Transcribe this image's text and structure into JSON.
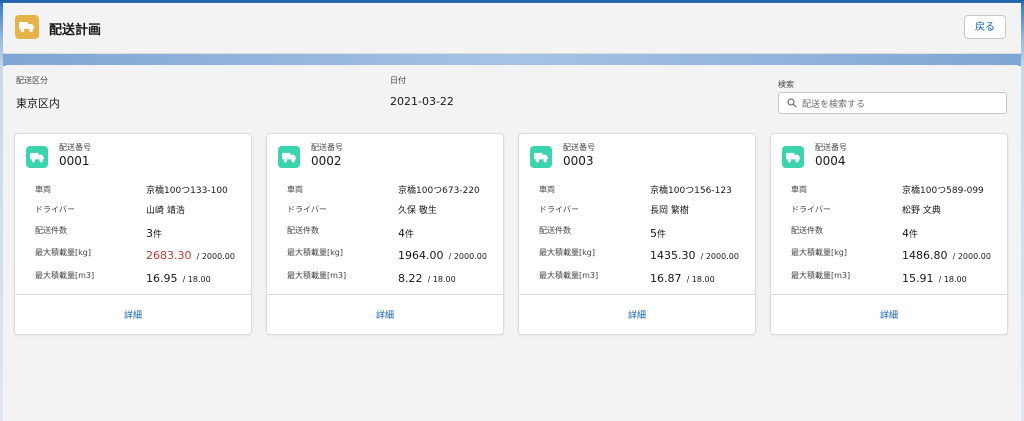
{
  "header": {
    "title": "配送計画",
    "back_label": "戻る"
  },
  "filters": {
    "area_label": "配送区分",
    "area_value": "東京区内",
    "date_label": "日付",
    "date_value": "2021-03-22",
    "search_label": "検索",
    "search_placeholder": "配送を検索する"
  },
  "card_labels": {
    "number": "配送番号",
    "vehicle": "車両",
    "driver": "ドライバー",
    "count": "配送件数",
    "max_weight": "最大積載量[kg]",
    "max_volume": "最大積載量[m3]",
    "detail": "詳細"
  },
  "colors": {
    "accent": "#0b5cab",
    "over_capacity": "#c23934",
    "truck_icon_bg": "#3bd4ae",
    "header_icon_bg": "#e4b448"
  },
  "cards": [
    {
      "number": "0001",
      "vehicle": "京橋100つ133-100",
      "driver": "山崎 靖浩",
      "count": "3",
      "count_suffix": "件",
      "weight": "2683.30",
      "weight_max": "/ 2000.00",
      "volume": "16.95",
      "volume_max": "/ 18.00"
    },
    {
      "number": "0002",
      "vehicle": "京橋100つ673-220",
      "driver": "久保 敬生",
      "count": "4",
      "count_suffix": "件",
      "weight": "1964.00",
      "weight_max": "/ 2000.00",
      "volume": "8.22",
      "volume_max": "/ 18.00"
    },
    {
      "number": "0003",
      "vehicle": "京橋100つ156-123",
      "driver": "長岡 繁樹",
      "count": "5",
      "count_suffix": "件",
      "weight": "1435.30",
      "weight_max": "/ 2000.00",
      "volume": "16.87",
      "volume_max": "/ 18.00"
    },
    {
      "number": "0004",
      "vehicle": "京橋100つ589-099",
      "driver": "松野 文典",
      "count": "4",
      "count_suffix": "件",
      "weight": "1486.80",
      "weight_max": "/ 2000.00",
      "volume": "15.91",
      "volume_max": "/ 18.00"
    }
  ]
}
